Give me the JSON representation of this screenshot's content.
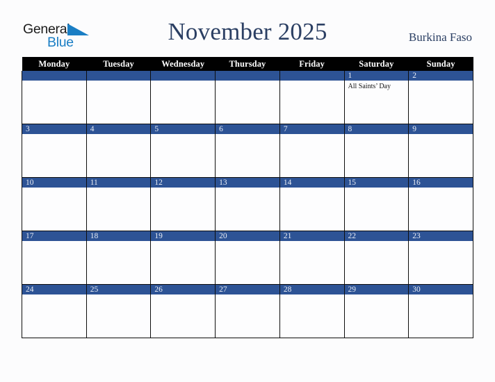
{
  "brand": {
    "word_one": "General",
    "word_two": "Blue",
    "mark_icon": "triangle-flag-icon",
    "mark_color": "#1a7ec4",
    "word_one_color": "#1b1b1b",
    "word_two_color": "#1a7ec4"
  },
  "header": {
    "title": "November 2025",
    "country": "Burkina Faso",
    "title_color": "#2b3f63"
  },
  "calendar": {
    "accent_color": "#2d5395",
    "header_bg": "#010101",
    "weekday_headers": [
      "Monday",
      "Tuesday",
      "Wednesday",
      "Thursday",
      "Friday",
      "Saturday",
      "Sunday"
    ],
    "weeks": [
      [
        {
          "day": "",
          "events": []
        },
        {
          "day": "",
          "events": []
        },
        {
          "day": "",
          "events": []
        },
        {
          "day": "",
          "events": []
        },
        {
          "day": "",
          "events": []
        },
        {
          "day": "1",
          "events": [
            "All Saints’ Day"
          ]
        },
        {
          "day": "2",
          "events": []
        }
      ],
      [
        {
          "day": "3",
          "events": []
        },
        {
          "day": "4",
          "events": []
        },
        {
          "day": "5",
          "events": []
        },
        {
          "day": "6",
          "events": []
        },
        {
          "day": "7",
          "events": []
        },
        {
          "day": "8",
          "events": []
        },
        {
          "day": "9",
          "events": []
        }
      ],
      [
        {
          "day": "10",
          "events": []
        },
        {
          "day": "11",
          "events": []
        },
        {
          "day": "12",
          "events": []
        },
        {
          "day": "13",
          "events": []
        },
        {
          "day": "14",
          "events": []
        },
        {
          "day": "15",
          "events": []
        },
        {
          "day": "16",
          "events": []
        }
      ],
      [
        {
          "day": "17",
          "events": []
        },
        {
          "day": "18",
          "events": []
        },
        {
          "day": "19",
          "events": []
        },
        {
          "day": "20",
          "events": []
        },
        {
          "day": "21",
          "events": []
        },
        {
          "day": "22",
          "events": []
        },
        {
          "day": "23",
          "events": []
        }
      ],
      [
        {
          "day": "24",
          "events": []
        },
        {
          "day": "25",
          "events": []
        },
        {
          "day": "26",
          "events": []
        },
        {
          "day": "27",
          "events": []
        },
        {
          "day": "28",
          "events": []
        },
        {
          "day": "29",
          "events": []
        },
        {
          "day": "30",
          "events": []
        }
      ]
    ]
  }
}
